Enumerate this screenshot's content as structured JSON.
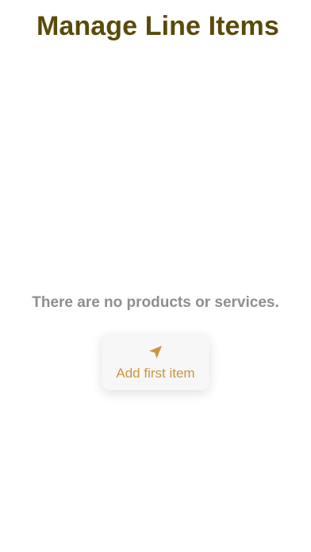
{
  "header": {
    "title": "Manage Line Items"
  },
  "empty_state": {
    "message": "There are no products or services.",
    "add_button": {
      "label": "Add first item",
      "icon": "paper-plane-icon"
    }
  },
  "colors": {
    "title": "#5a4a0a",
    "message": "#8e8e93",
    "accent": "#c9973f",
    "button_bg": "#f7f7f7"
  }
}
